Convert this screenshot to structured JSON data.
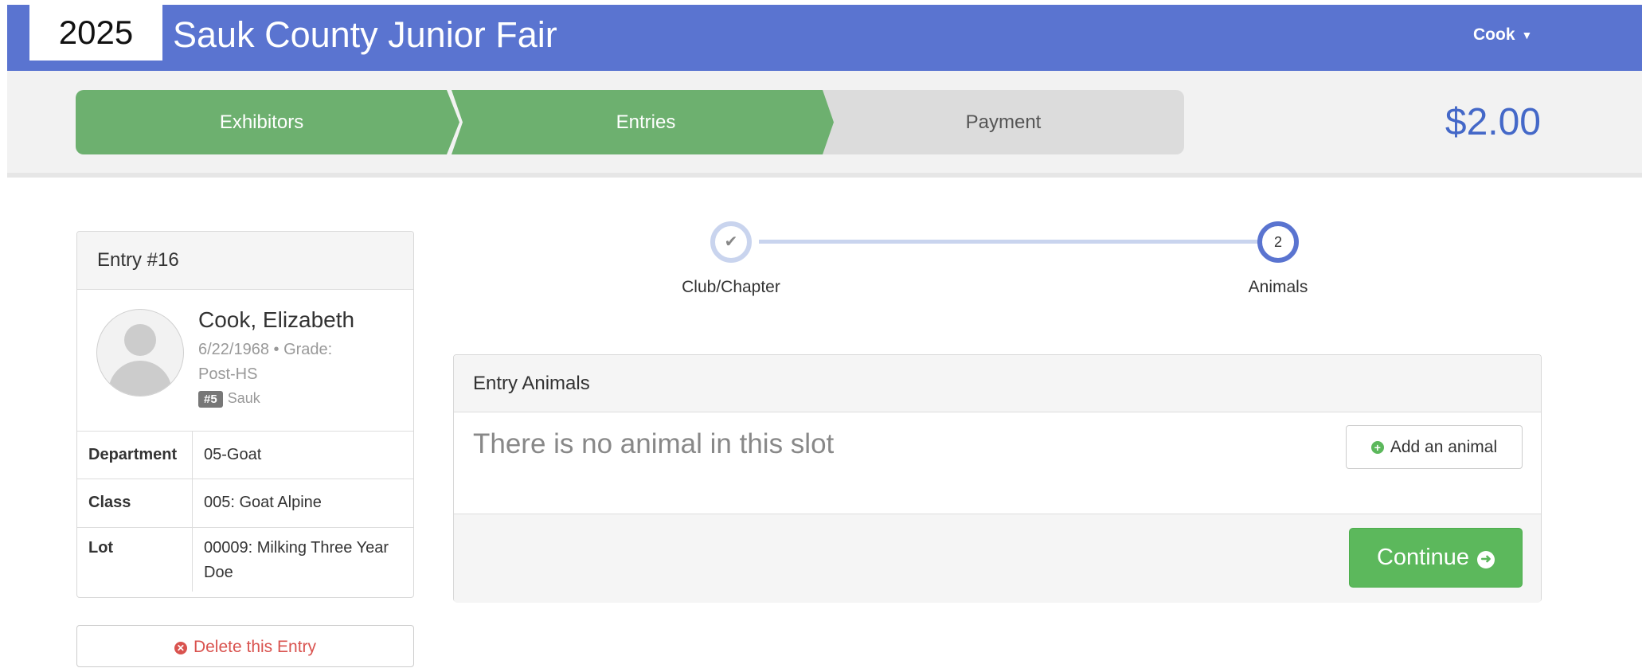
{
  "header": {
    "year_badge": "2025",
    "brand": "Sauk County Junior Fair",
    "user_menu_label": "Cook"
  },
  "progress": {
    "steps": [
      {
        "label": "Exhibitors",
        "state": "done"
      },
      {
        "label": "Entries",
        "state": "done"
      },
      {
        "label": "Payment",
        "state": "todo"
      }
    ],
    "total": "$2.00"
  },
  "entry": {
    "title": "Entry #16",
    "name": "Cook, Elizabeth",
    "meta": "6/22/1968 • Grade: Post-HS",
    "club_number": "#5",
    "club_name": "Sauk",
    "details": [
      {
        "key": "Department",
        "value": "05-Goat"
      },
      {
        "key": "Class",
        "value": "005: Goat Alpine"
      },
      {
        "key": "Lot",
        "value": "00009: Milking Three Year Doe"
      }
    ],
    "delete_label": "Delete this Entry"
  },
  "wizard": {
    "steps": [
      {
        "label": "Club/Chapter",
        "marker": "✔",
        "state": "complete"
      },
      {
        "label": "Animals",
        "marker": "2",
        "state": "current"
      }
    ]
  },
  "animals_panel": {
    "title": "Entry Animals",
    "empty_text": "There is no animal in this slot",
    "add_label": "Add an animal",
    "continue_label": "Continue"
  },
  "colors": {
    "topbar": "#5a74d0",
    "step_done": "#6db06f",
    "step_todo": "#dcdcdc",
    "total_text": "#4468c8",
    "danger": "#d9534f",
    "success": "#5cb85c"
  }
}
